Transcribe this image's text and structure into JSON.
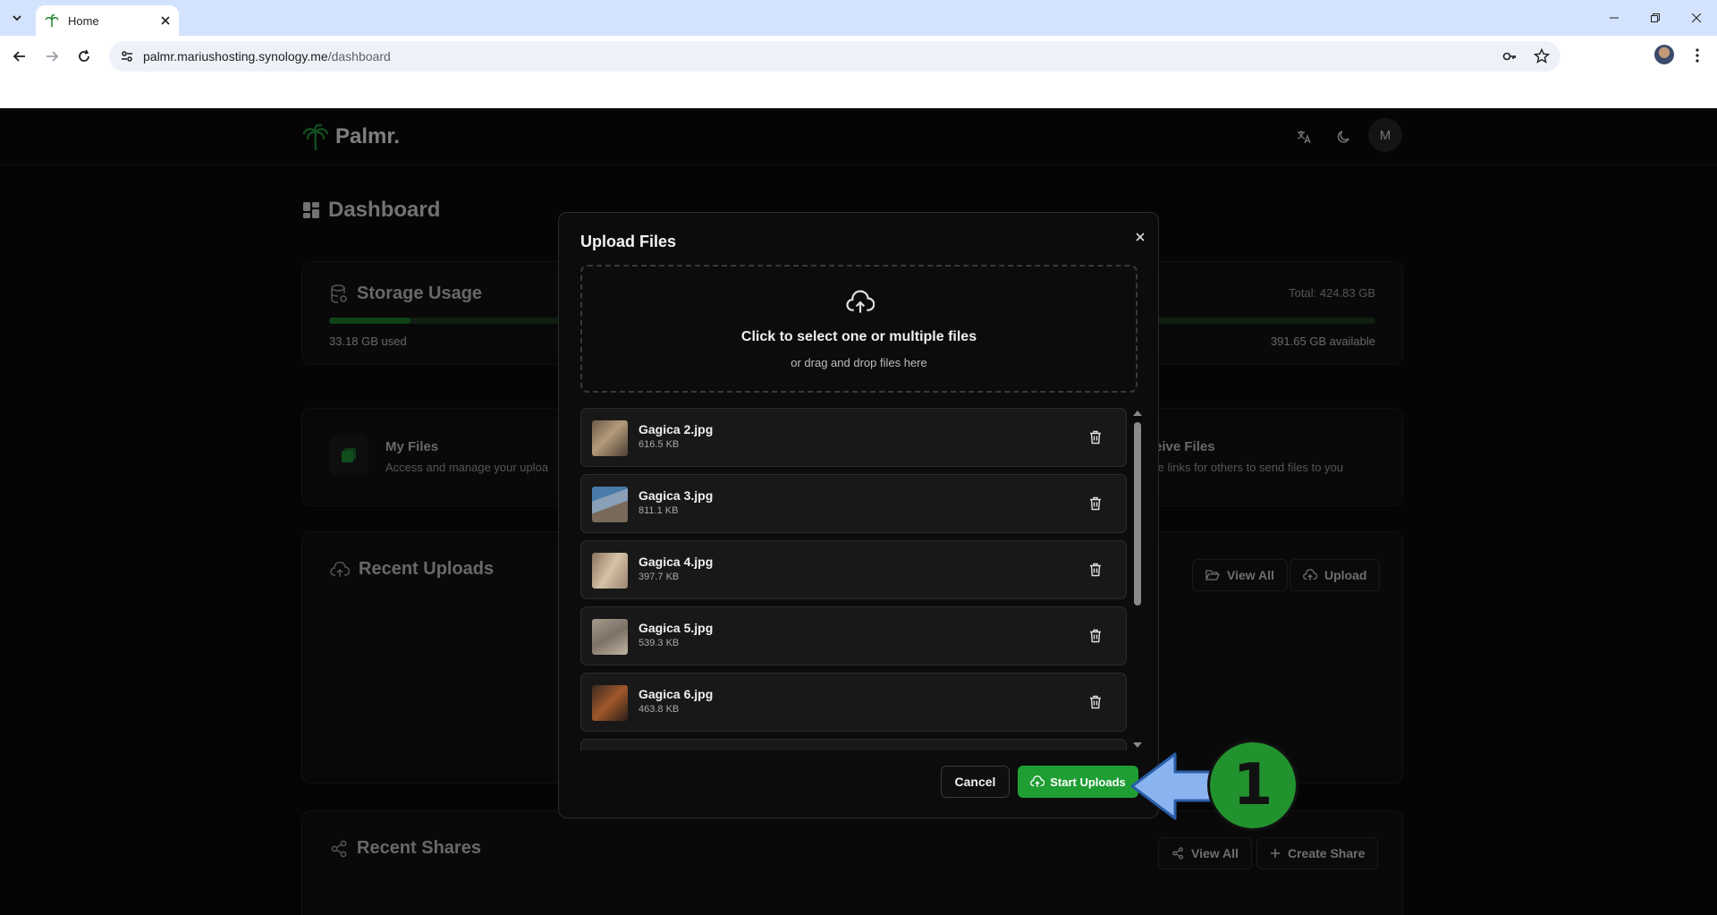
{
  "browser": {
    "tab_title": "Home",
    "url_host": "palmr.mariushosting.synology.me",
    "url_path": "/dashboard"
  },
  "app": {
    "brand": "Palmr.",
    "avatar_letter": "M",
    "page_title": "Dashboard",
    "accent_color": "#1f9e34"
  },
  "storage": {
    "title": "Storage Usage",
    "total": "Total: 424.83 GB",
    "used": "33.18 GB used",
    "available": "391.65 GB available",
    "used_fraction": 0.078
  },
  "quick_cards": {
    "my_files_title": "My Files",
    "my_files_desc": "Access and manage your uploa",
    "receive_title": "eive Files",
    "receive_desc": "te links for others to send files to you"
  },
  "recent_uploads": {
    "title": "Recent Uploads",
    "view_all": "View All",
    "upload": "Upload"
  },
  "recent_shares": {
    "title": "Recent Shares",
    "view_all": "View All",
    "create_share": "Create Share"
  },
  "modal": {
    "title": "Upload Files",
    "dropzone_title": "Click to select one or multiple files",
    "dropzone_sub": "or drag and drop files here",
    "cancel": "Cancel",
    "start": "Start Uploads",
    "files": [
      {
        "name": "Gagica 2.jpg",
        "size": "616.5 KB"
      },
      {
        "name": "Gagica 3.jpg",
        "size": "811.1 KB"
      },
      {
        "name": "Gagica 4.jpg",
        "size": "397.7 KB"
      },
      {
        "name": "Gagica 5.jpg",
        "size": "539.3 KB"
      },
      {
        "name": "Gagica 6.jpg",
        "size": "463.8 KB"
      }
    ]
  },
  "callout": {
    "number": "1"
  }
}
